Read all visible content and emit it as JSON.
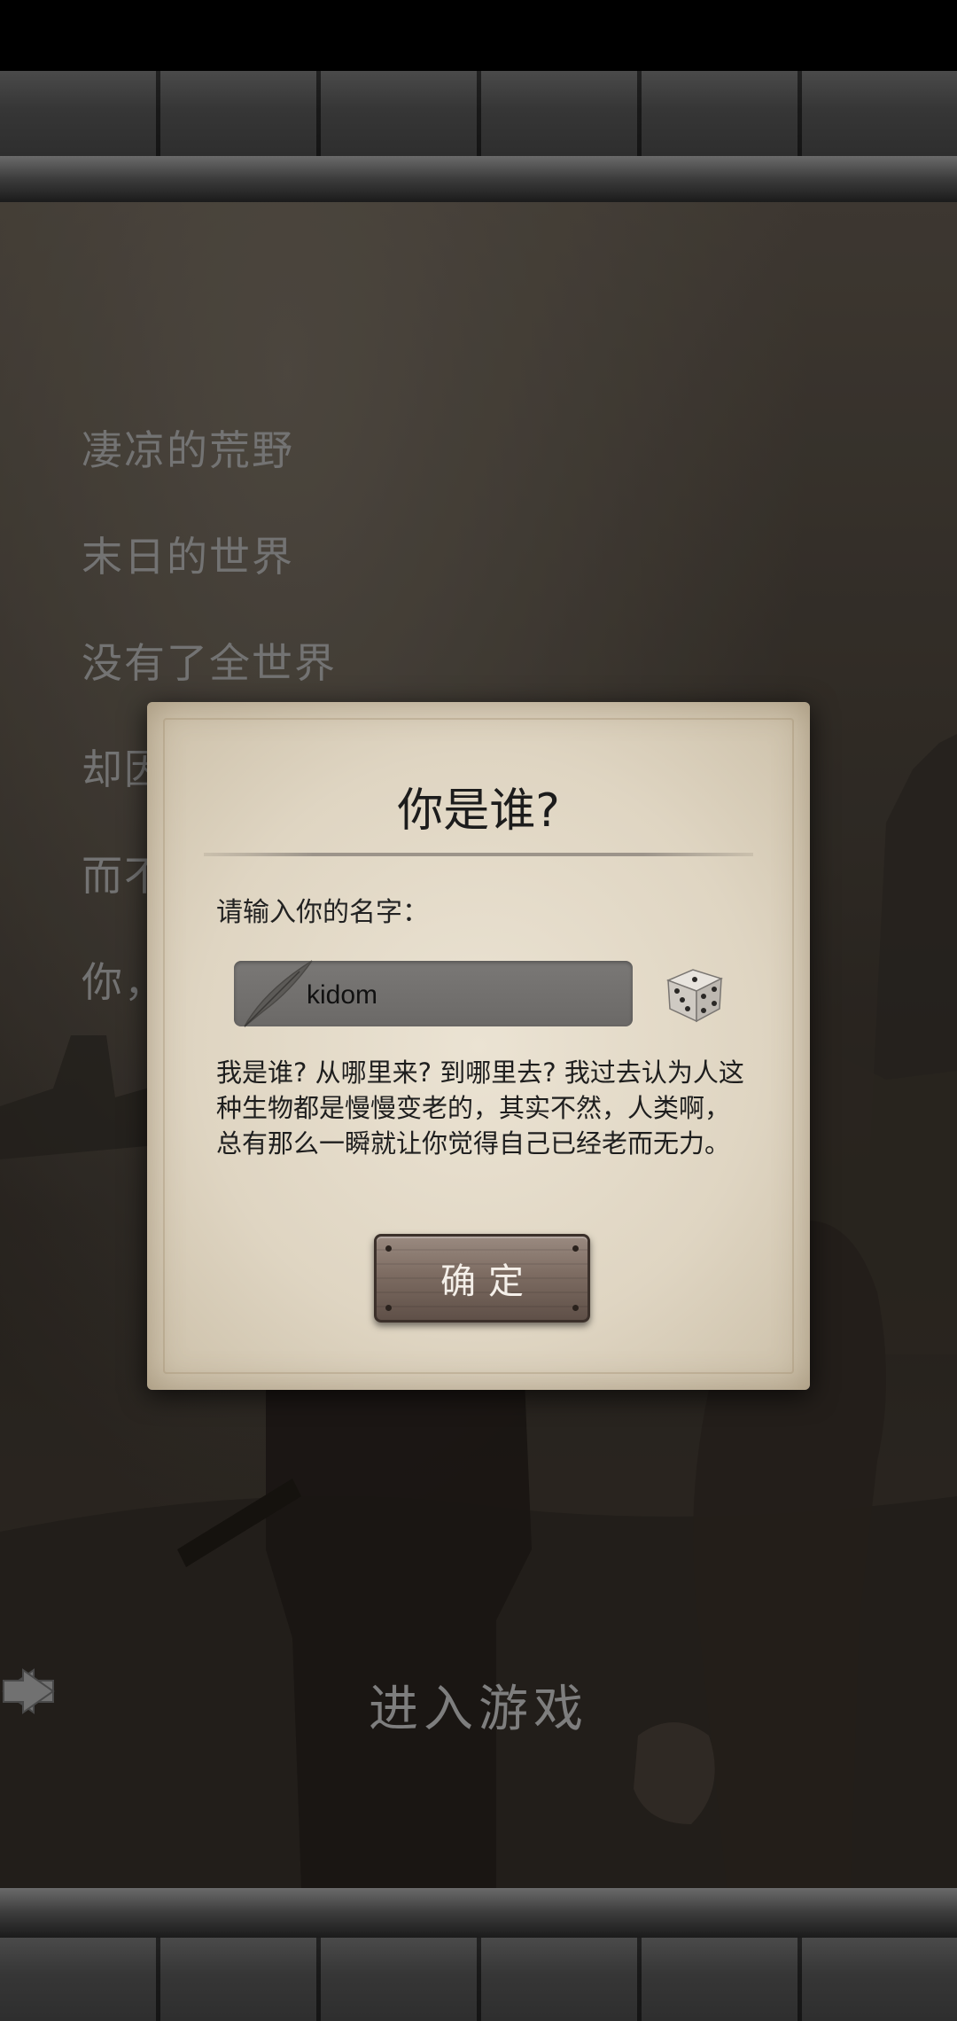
{
  "intro": {
    "lines": [
      "凄凉的荒野",
      "末日的世界",
      "没有了全世界",
      "却因",
      "而不",
      "你，"
    ]
  },
  "enter_game": {
    "label": "进入游戏"
  },
  "dialog": {
    "title": "你是谁?",
    "name_label": "请输入你的名字：",
    "name_value": "kidom",
    "story": "我是谁? 从哪里来? 到哪里去? 我过去认为人这种生物都是慢慢变老的，其实不然，人类啊，总有那么一瞬就让你觉得自己已经老而无力。",
    "confirm_label": "确定",
    "icons": {
      "quill": "quill-icon",
      "dice": "dice-icon"
    }
  }
}
